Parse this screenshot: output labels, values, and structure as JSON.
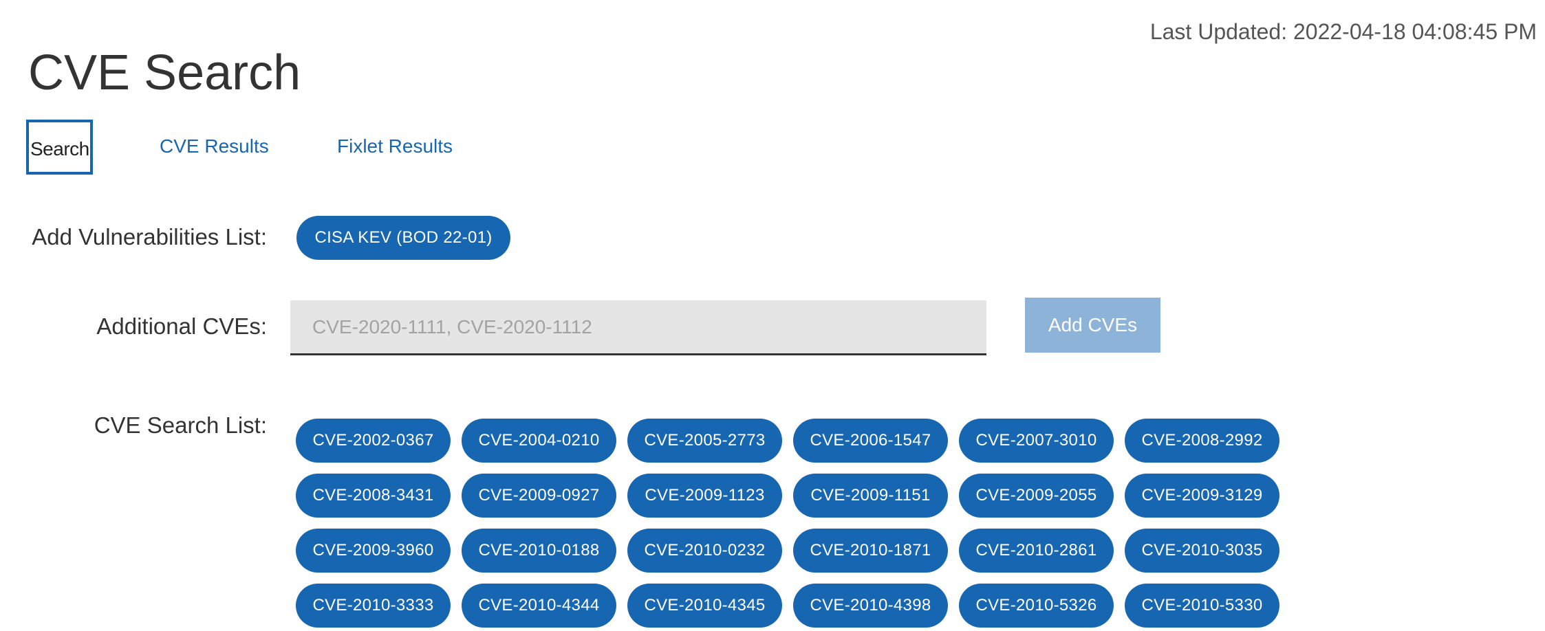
{
  "header": {
    "last_updated": "Last Updated: 2022-04-18 04:08:45 PM",
    "title": "CVE Search"
  },
  "tabs": [
    {
      "label": "Search",
      "active": true
    },
    {
      "label": "CVE Results",
      "active": false
    },
    {
      "label": "Fixlet Results",
      "active": false
    }
  ],
  "vulnerabilities": {
    "label": "Add Vulnerabilities List:",
    "lists": [
      "CISA KEV (BOD 22-01)"
    ]
  },
  "additional": {
    "label": "Additional CVEs:",
    "value": "",
    "placeholder": "CVE-2020-1111, CVE-2020-1112",
    "button_label": "Add CVEs"
  },
  "search_list": {
    "label": "CVE Search List:",
    "items": [
      "CVE-2002-0367",
      "CVE-2004-0210",
      "CVE-2005-2773",
      "CVE-2006-1547",
      "CVE-2007-3010",
      "CVE-2008-2992",
      "CVE-2008-3431",
      "CVE-2009-0927",
      "CVE-2009-1123",
      "CVE-2009-1151",
      "CVE-2009-2055",
      "CVE-2009-3129",
      "CVE-2009-3960",
      "CVE-2010-0188",
      "CVE-2010-0232",
      "CVE-2010-1871",
      "CVE-2010-2861",
      "CVE-2010-3035",
      "CVE-2010-3333",
      "CVE-2010-4344",
      "CVE-2010-4345",
      "CVE-2010-4398",
      "CVE-2010-5326",
      "CVE-2010-5330"
    ]
  },
  "colors": {
    "accent": "#1766b2",
    "button_disabled": "#8eb3d9",
    "input_bg": "#e5e5e5"
  }
}
